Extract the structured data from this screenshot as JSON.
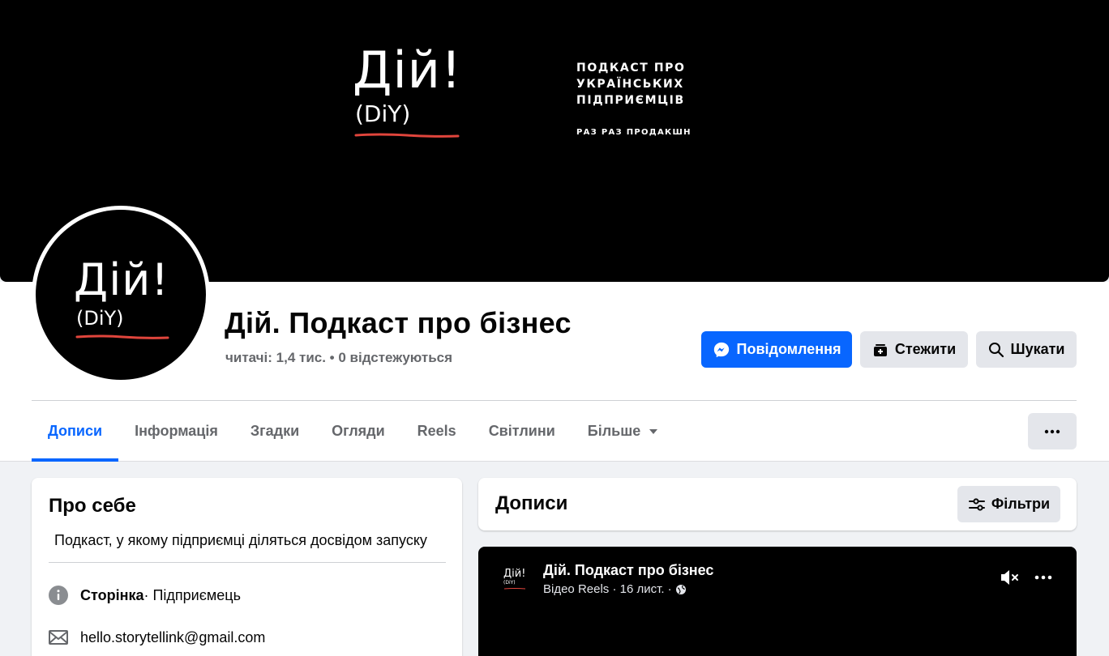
{
  "cover": {
    "logo_main": "Дій!",
    "logo_sub": "(DiY)",
    "tagline_lines": [
      "ПОДКАСТ ПРО",
      "УКРАЇНСЬКИХ",
      "ПІДПРИЄМЦІВ"
    ],
    "producer": "РАЗ РАЗ ПРОДАКШН"
  },
  "profile": {
    "avatar_main": "Дій!",
    "avatar_sub": "(DiY)",
    "name": "Дій. Подкаст про бізнес",
    "stats": "читачі: 1,4 тис. • 0 відстежуються"
  },
  "actions": {
    "message": "Повідомлення",
    "follow": "Стежити",
    "search": "Шукати"
  },
  "tabs": [
    {
      "label": "Дописи",
      "active": true
    },
    {
      "label": "Інформація"
    },
    {
      "label": "Згадки"
    },
    {
      "label": "Огляди"
    },
    {
      "label": "Reels"
    },
    {
      "label": "Світлини"
    },
    {
      "label": "Більше"
    }
  ],
  "about": {
    "title": "Про себе",
    "description": "Подкаст, у якому підприємці діляться досвідом запуску",
    "page_label": "Сторінка",
    "page_category": " · Підприємець",
    "email": "hello.storytellink@gmail.com"
  },
  "posts": {
    "title": "Дописи",
    "filters": "Фільтри"
  },
  "reel": {
    "avatar_main": "Дій!",
    "avatar_sub": "(DiY)",
    "author": "Дій. Подкаст про бізнес",
    "meta": "Відео Reels · 16 лист. ·"
  },
  "colors": {
    "accent": "#0866ff",
    "underline_red": "#e0453c",
    "secondary_button": "#e4e6eb",
    "muted_text": "#65676b"
  }
}
